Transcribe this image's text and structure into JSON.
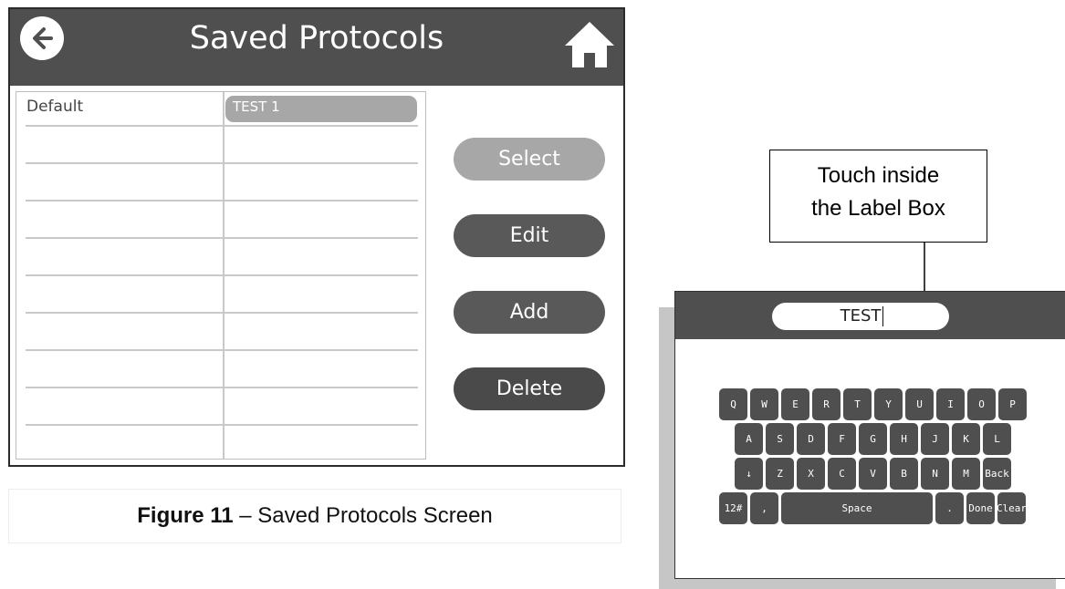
{
  "header": {
    "title": "Saved Protocols",
    "back_icon": "arrow-left-icon",
    "home_icon": "home-icon"
  },
  "table": {
    "rows": [
      [
        "Default",
        "TEST 1"
      ],
      [
        "",
        ""
      ],
      [
        "",
        ""
      ],
      [
        "",
        ""
      ],
      [
        "",
        ""
      ],
      [
        "",
        ""
      ],
      [
        "",
        ""
      ],
      [
        "",
        ""
      ],
      [
        "",
        ""
      ]
    ],
    "selected_row": 0
  },
  "buttons": {
    "select": "Select",
    "edit": "Edit",
    "add": "Add",
    "delete": "Delete"
  },
  "colors": {
    "header": "#4f4f4f",
    "select_button": "#a7a7a7",
    "button": "#595959",
    "delete_button": "#4a4a4a"
  },
  "caption": {
    "figure": "Figure 11",
    "text": " – Saved Protocols Screen"
  },
  "callout": {
    "line1": "Touch inside",
    "line2": "the Label Box"
  },
  "keyboard": {
    "label_value": "TEST",
    "rows": [
      [
        "Q",
        "W",
        "E",
        "R",
        "T",
        "Y",
        "U",
        "I",
        "O",
        "P"
      ],
      [
        "A",
        "S",
        "D",
        "F",
        "G",
        "H",
        "J",
        "K",
        "L"
      ],
      [
        "↓",
        "Z",
        "X",
        "C",
        "V",
        "B",
        "N",
        "M",
        "Back"
      ],
      [
        "12#",
        ",",
        "Space",
        ".",
        "Done",
        "Clear"
      ]
    ]
  }
}
